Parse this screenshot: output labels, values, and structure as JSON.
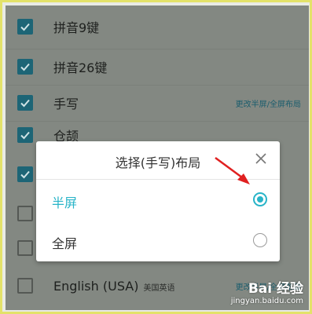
{
  "settings_list": {
    "rows": [
      {
        "label": "拼音9键",
        "checked": true
      },
      {
        "label": "拼音26键",
        "checked": true
      },
      {
        "label": "手写",
        "checked": true,
        "link": "更改半屏/全屏布局"
      },
      {
        "label": "仓颉",
        "checked": true
      },
      {
        "label": "",
        "checked": true
      },
      {
        "label": "",
        "checked": false
      },
      {
        "label": "",
        "checked": false
      },
      {
        "label": "English (USA)",
        "sublabel": "美国英语",
        "checked": false,
        "link": "更改半屏/全屏布局"
      }
    ]
  },
  "dialog": {
    "title": "选择(手写)布局",
    "close_icon": "close-icon",
    "options": [
      {
        "label": "半屏",
        "selected": true
      },
      {
        "label": "全屏",
        "selected": false
      }
    ]
  },
  "watermark": {
    "logo": "Bai 经验",
    "url": "jingyan.baidu.com"
  },
  "colors": {
    "accent": "#28b4c8",
    "checkbox": "#1d6576",
    "overlay_bg": "#838882",
    "frame": "#e3e26a",
    "arrow": "#e02020"
  }
}
